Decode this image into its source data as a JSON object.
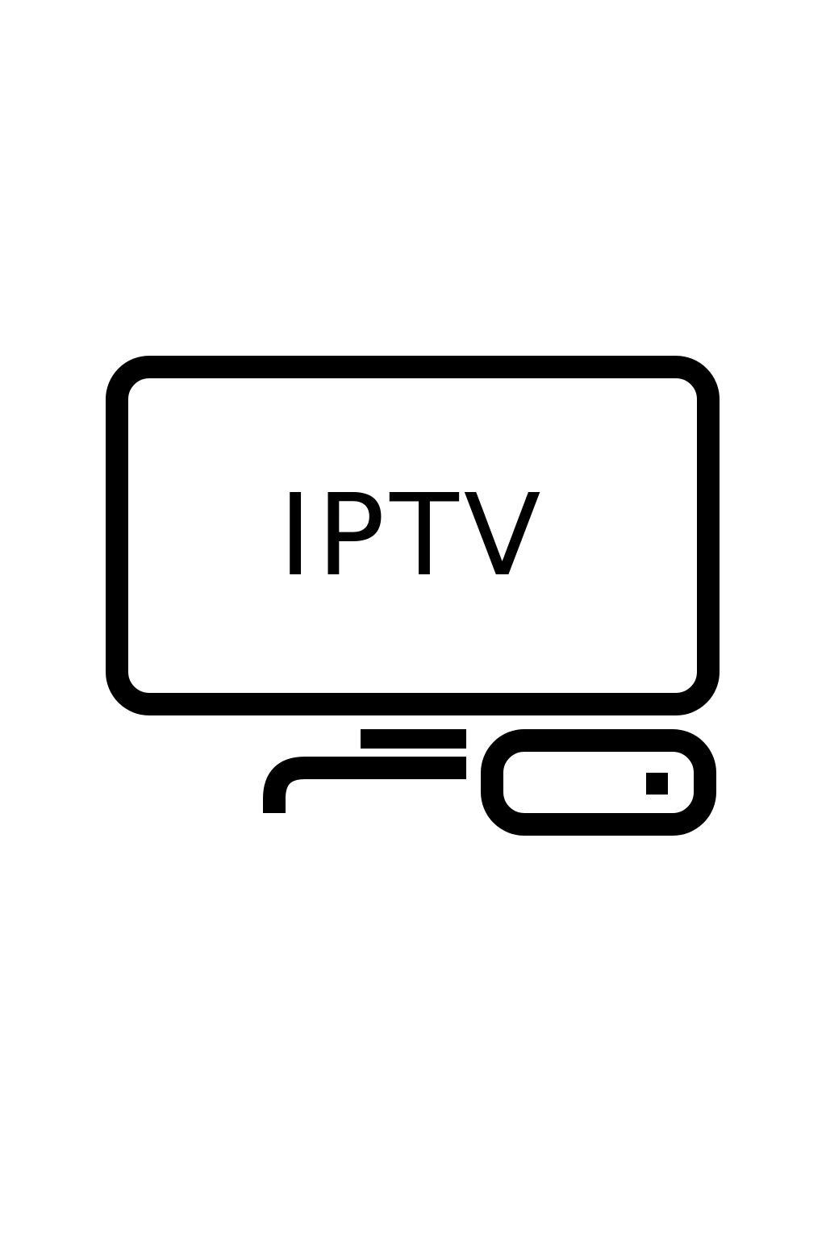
{
  "icon": {
    "name": "iptv-tv-with-set-top-box",
    "screen_text": "IPTV",
    "stroke_color": "#000000",
    "background_color": "#ffffff"
  }
}
